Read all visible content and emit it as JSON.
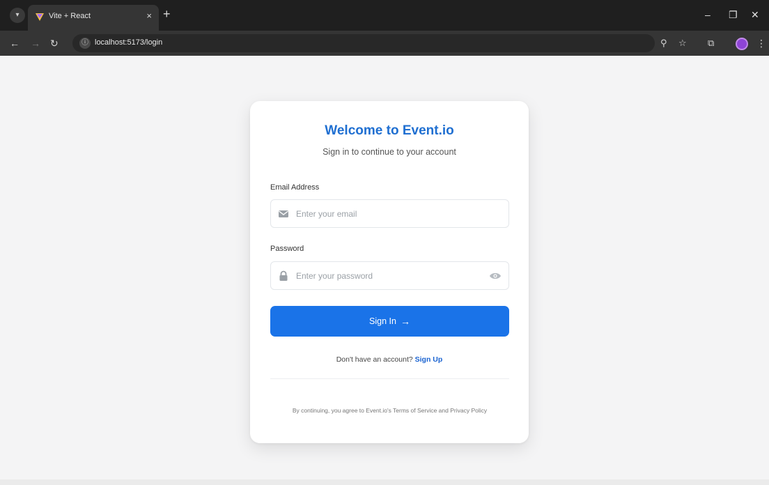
{
  "browser": {
    "tab_title": "Vite + React",
    "tab_close": "×",
    "new_tab": "+",
    "url": "localhost:5173/login",
    "icons": {
      "tab_menu": "chevron-down-icon",
      "back": "arrow-left-icon",
      "forward": "arrow-right-icon",
      "reload": "reload-icon",
      "site_info": "site-info-icon",
      "zoom": "zoom-icon",
      "bookmark": "star-icon",
      "extensions": "puzzle-icon",
      "menu": "more-vertical-icon"
    }
  },
  "login": {
    "title": "Welcome to Event.io",
    "subtitle": "Sign in to continue to your account",
    "email_label": "Email Address",
    "email_placeholder": "Enter your email",
    "password_label": "Password",
    "password_placeholder": "Enter your password",
    "submit_label": "Sign In",
    "submit_arrow": "→",
    "signup_prompt": "Don't have an account?",
    "signup_link": "Sign Up",
    "terms": "By continuing, you agree to Event.io's Terms of Service and Privacy Policy"
  },
  "colors": {
    "accent": "#1a73e8",
    "title": "#1f6fd1",
    "page_bg": "#f4f4f5",
    "card_bg": "#ffffff"
  }
}
